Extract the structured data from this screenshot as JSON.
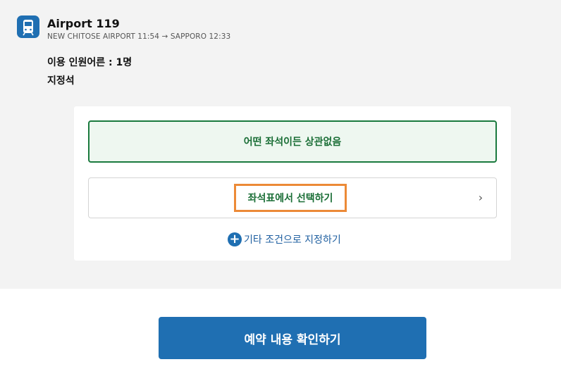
{
  "train": {
    "icon": "train-icon",
    "name": "Airport 119",
    "route": "NEW CHITOSE AIRPORT 11:54 → SAPPORO 12:33"
  },
  "booking": {
    "passengers": "이용 인원어른 : 1명",
    "seat_class": "지정석"
  },
  "seat_options": {
    "any_seat_label": "어떤 좌석이든 상관없음",
    "seat_map_label": "좌석표에서 선택하기",
    "other_conditions_label": "기타 조건으로 지정하기"
  },
  "footer": {
    "confirm_label": "예약 내용 확인하기"
  },
  "colors": {
    "primary": "#1f6fb2",
    "green": "#1a7a3e",
    "highlight": "#ec8a37"
  }
}
